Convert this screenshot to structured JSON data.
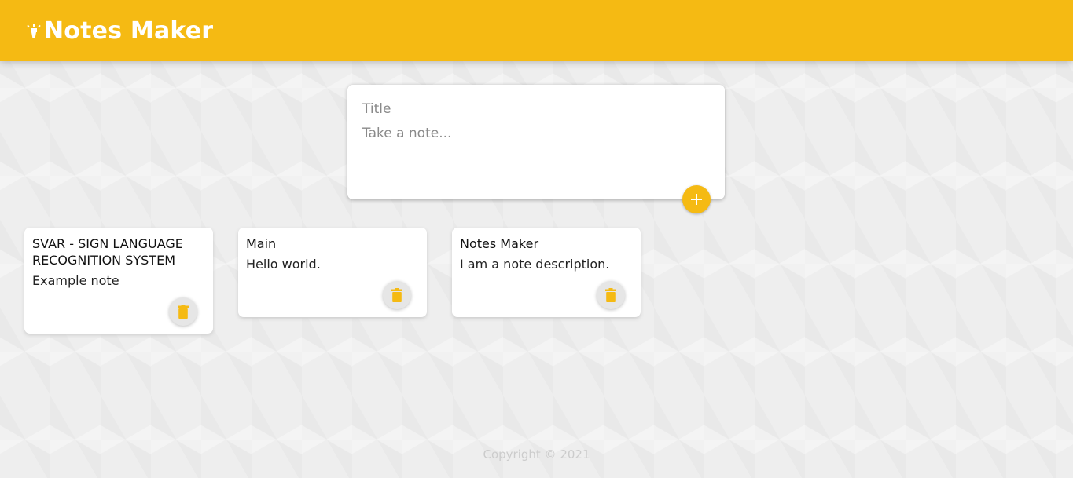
{
  "header": {
    "title": "Notes Maker",
    "icon": "highlighter-icon",
    "color": "#f5ba13"
  },
  "create_note": {
    "title_placeholder": "Title",
    "content_placeholder": "Take a note...",
    "add_icon": "plus-icon"
  },
  "notes": [
    {
      "title": "SVAR - SIGN LANGUAGE RECOGNITION SYSTEM",
      "content": "Example note",
      "delete_icon": "trash-icon"
    },
    {
      "title": "Main",
      "content": "Hello world.",
      "delete_icon": "trash-icon"
    },
    {
      "title": "Notes Maker",
      "content": "I am a note description.",
      "delete_icon": "trash-icon"
    }
  ],
  "footer": {
    "copyright": "Copyright © 2021"
  },
  "colors": {
    "accent": "#f5ba13",
    "background": "#eeeeee",
    "card": "#ffffff",
    "footer_text": "#cccccc"
  }
}
